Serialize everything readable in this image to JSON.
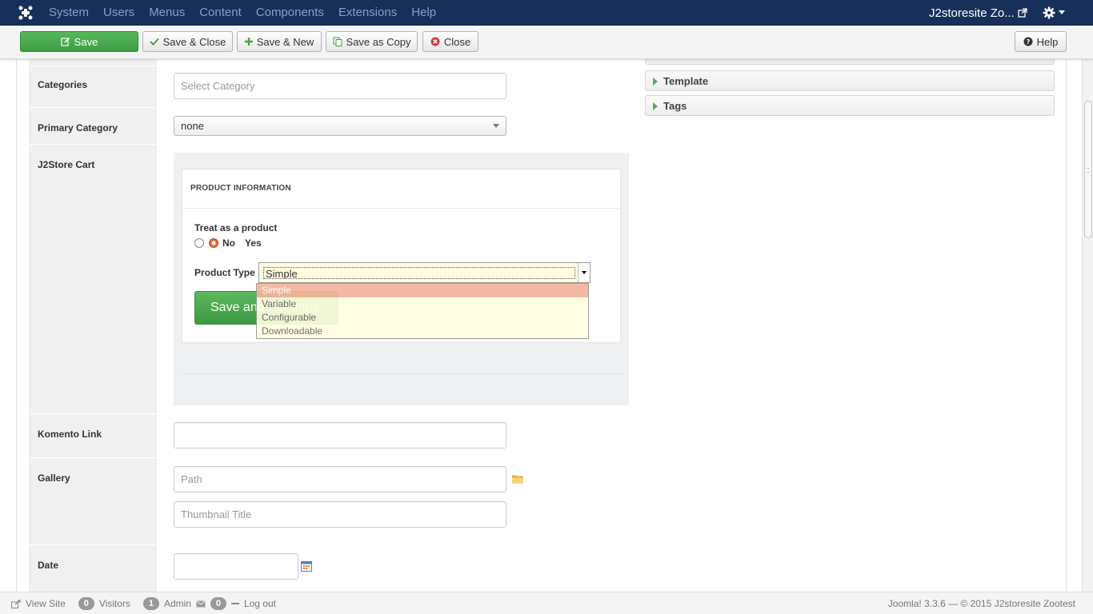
{
  "nav": {
    "menu": [
      "System",
      "Users",
      "Menus",
      "Content",
      "Components",
      "Extensions",
      "Help"
    ],
    "site_name": "J2storesite Zo..."
  },
  "toolbar": {
    "save": "Save",
    "save_close": "Save & Close",
    "save_new": "Save & New",
    "save_copy": "Save as Copy",
    "close": "Close",
    "help": "Help"
  },
  "form": {
    "categories_label": "Categories",
    "categories_placeholder": "Select Category",
    "primary_category_label": "Primary Category",
    "primary_category_value": "none",
    "j2store_label": "J2Store Cart",
    "komento_label": "Komento Link",
    "komento_value": "",
    "gallery_label": "Gallery",
    "gallery_path_placeholder": "Path",
    "gallery_thumb_placeholder": "Thumbnail Title",
    "date_label": "Date",
    "date_value": ""
  },
  "j2store": {
    "header": "PRODUCT INFORMATION",
    "treat_label": "Treat as a product",
    "radio_no": "No",
    "radio_yes": "Yes",
    "product_type_label": "Product Type",
    "product_type_value": "Simple",
    "save_continue": "Save and Continue",
    "options": [
      "Simple",
      "Variable",
      "Configurable",
      "Downloadable"
    ]
  },
  "sidebar": {
    "accordions": [
      "Template",
      "Tags"
    ]
  },
  "status": {
    "view_site": "View Site",
    "visitors_count": "0",
    "visitors_label": "Visitors",
    "admin_count": "1",
    "admin_label": "Admin",
    "messages_count": "0",
    "logout": "Log out",
    "footer": "Joomla! 3.3.6  —  © 2015 J2storesite Zootest"
  },
  "colors": {
    "navbar": "#17305a",
    "save_green": "#46a546",
    "dropdown_selected": "#f4b49c"
  }
}
